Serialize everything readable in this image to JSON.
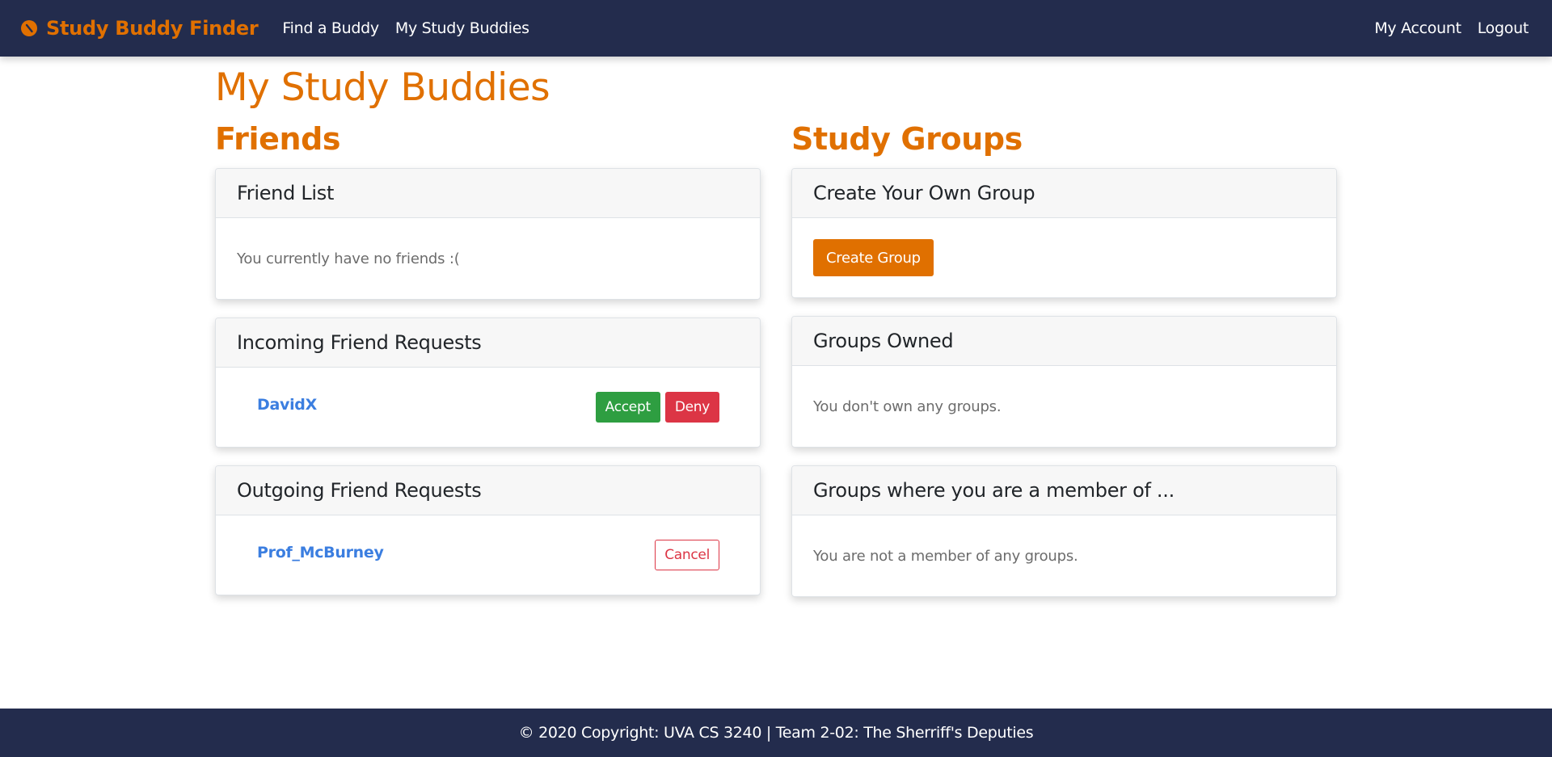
{
  "navbar": {
    "brand": "Study Buddy Finder",
    "brand_icon": "compass-icon",
    "brand_color": "#e07000",
    "background": "#232c4d",
    "links_left": [
      "Find a Buddy",
      "My Study Buddies"
    ],
    "links_right": [
      "My Account",
      "Logout"
    ]
  },
  "page_title": "My Study Buddies",
  "friends": {
    "title": "Friends",
    "friend_list": {
      "header": "Friend List",
      "empty_text": "You currently have no friends :("
    },
    "incoming": {
      "header": "Incoming Friend Requests",
      "user": "DavidX",
      "accept_label": "Accept",
      "deny_label": "Deny"
    },
    "outgoing": {
      "header": "Outgoing Friend Requests",
      "user": "Prof_McBurney",
      "cancel_label": "Cancel"
    }
  },
  "groups": {
    "title": "Study Groups",
    "create": {
      "header": "Create Your Own Group",
      "button_label": "Create Group"
    },
    "owned": {
      "header": "Groups Owned",
      "empty_text": "You don't own any groups."
    },
    "member": {
      "header": "Groups where you are a member of ...",
      "empty_text": "You are not a member of any groups."
    }
  },
  "footer": {
    "text": "© 2020 Copyright: UVA CS 3240 | Team 2-02: The Sherriff's Deputies"
  },
  "colors": {
    "accent": "#e07000",
    "success": "#2e9e41",
    "danger": "#dc3545",
    "link": "#3b7ee0"
  }
}
